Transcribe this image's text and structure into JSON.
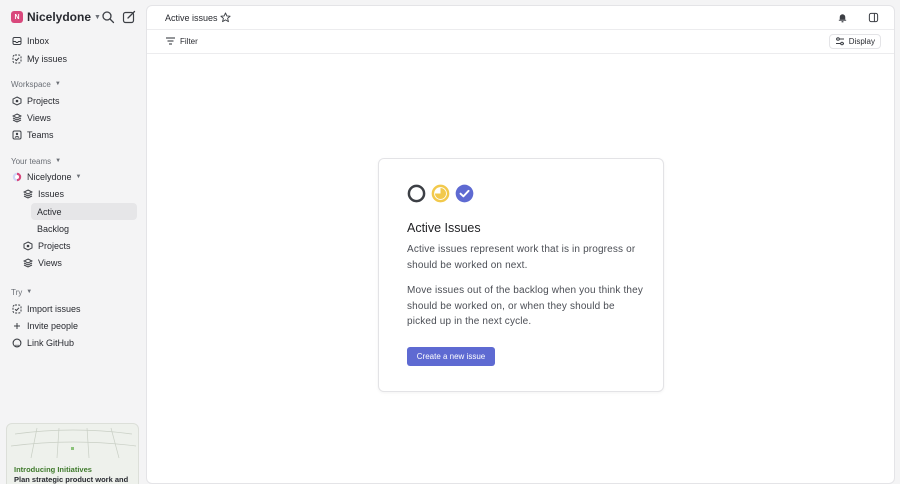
{
  "workspace": {
    "initial": "N",
    "name": "Nicelydone"
  },
  "sidebar": {
    "top_items": [
      {
        "label": "Inbox"
      },
      {
        "label": "My issues"
      }
    ],
    "workspace_section": {
      "heading": "Workspace",
      "items": [
        {
          "label": "Projects"
        },
        {
          "label": "Views"
        },
        {
          "label": "Teams"
        }
      ]
    },
    "teams_section": {
      "heading": "Your teams",
      "team_name": "Nicelydone",
      "issues_label": "Issues",
      "sub_items": [
        {
          "label": "Active"
        },
        {
          "label": "Backlog"
        }
      ],
      "projects_label": "Projects",
      "views_label": "Views"
    },
    "try_section": {
      "heading": "Try",
      "items": [
        {
          "label": "Import issues"
        },
        {
          "label": "Invite people"
        },
        {
          "label": "Link GitHub"
        }
      ]
    },
    "promo": {
      "title": "Introducing Initiatives",
      "text": "Plan strategic product work and"
    }
  },
  "header": {
    "title": "Active issues"
  },
  "toolbar": {
    "filter_label": "Filter",
    "display_label": "Display"
  },
  "empty_state": {
    "title": "Active Issues",
    "paragraph1": "Active issues represent work that is in progress or should be worked on next.",
    "paragraph2": "Move issues out of the backlog when you think they should be worked on, or when they should be picked up in the next cycle.",
    "button_label": "Create a new issue"
  },
  "colors": {
    "accent": "#5e6ad2",
    "in_progress": "#f2c94c",
    "brand": "#d9487c"
  }
}
